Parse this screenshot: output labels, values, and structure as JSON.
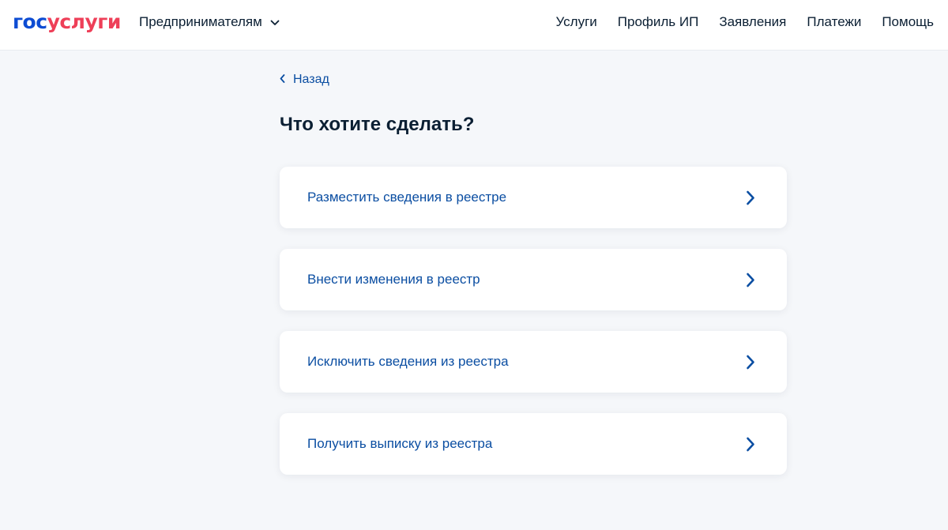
{
  "header": {
    "logo_part1": "гос",
    "logo_part2": "услуги",
    "section_label": "Предпринимателям",
    "nav": [
      "Услуги",
      "Профиль ИП",
      "Заявления",
      "Платежи",
      "Помощь"
    ]
  },
  "back_label": "Назад",
  "page_title": "Что хотите сделать?",
  "options": [
    "Разместить сведения в реестре",
    "Внести изменения в реестр",
    "Исключить сведения из реестра",
    "Получить выписку из реестра"
  ],
  "icons": {
    "section": "chevron-down-icon",
    "back": "chevron-left-icon",
    "option": "chevron-right-icon"
  },
  "colors": {
    "brand_blue": "#0d4cd3",
    "brand_red": "#ee3f58",
    "link": "#0b4ea2",
    "text": "#0b1f33",
    "background": "#f5f7fa"
  }
}
